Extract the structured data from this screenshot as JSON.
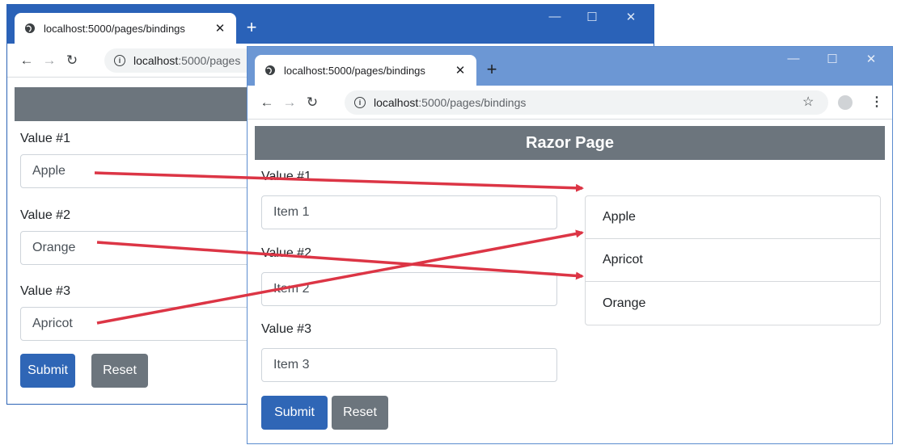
{
  "back_window": {
    "tab_title": "localhost:5000/pages/bindings",
    "new_tab": "+",
    "controls": {
      "minimize": "—",
      "maximize": "☐",
      "close": "✕"
    },
    "url_host": "localhost",
    "url_path": ":5000/pages",
    "form": {
      "fields": [
        {
          "label": "Value #1",
          "value": "Apple"
        },
        {
          "label": "Value #2",
          "value": "Orange"
        },
        {
          "label": "Value #3",
          "value": "Apricot"
        }
      ],
      "submit_label": "Submit",
      "reset_label": "Reset"
    }
  },
  "front_window": {
    "tab_title": "localhost:5000/pages/bindings",
    "new_tab": "+",
    "controls": {
      "minimize": "—",
      "maximize": "☐",
      "close": "✕"
    },
    "url_host": "localhost",
    "url_path": ":5000/pages/bindings",
    "header": "Razor Page",
    "form": {
      "fields": [
        {
          "label": "Value #1",
          "value": "Item 1"
        },
        {
          "label": "Value #2",
          "value": "Item 2"
        },
        {
          "label": "Value #3",
          "value": "Item 3"
        }
      ],
      "submit_label": "Submit",
      "reset_label": "Reset"
    },
    "results": [
      "Apple",
      "Apricot",
      "Orange"
    ]
  },
  "colors": {
    "arrow": "#dc3545",
    "primary": "#2f66b6",
    "secondary": "#6c757d",
    "titlebar_back": "#2a62b8",
    "titlebar_front": "#6c97d4"
  }
}
